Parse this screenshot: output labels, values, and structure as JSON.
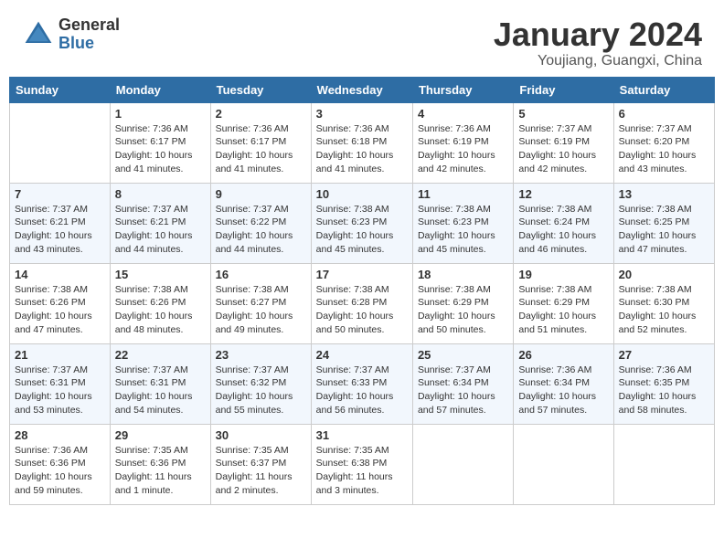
{
  "header": {
    "logo_general": "General",
    "logo_blue": "Blue",
    "month_title": "January 2024",
    "location": "Youjiang, Guangxi, China"
  },
  "weekdays": [
    "Sunday",
    "Monday",
    "Tuesday",
    "Wednesday",
    "Thursday",
    "Friday",
    "Saturday"
  ],
  "weeks": [
    [
      {
        "num": "",
        "info": ""
      },
      {
        "num": "1",
        "info": "Sunrise: 7:36 AM\nSunset: 6:17 PM\nDaylight: 10 hours\nand 41 minutes."
      },
      {
        "num": "2",
        "info": "Sunrise: 7:36 AM\nSunset: 6:17 PM\nDaylight: 10 hours\nand 41 minutes."
      },
      {
        "num": "3",
        "info": "Sunrise: 7:36 AM\nSunset: 6:18 PM\nDaylight: 10 hours\nand 41 minutes."
      },
      {
        "num": "4",
        "info": "Sunrise: 7:36 AM\nSunset: 6:19 PM\nDaylight: 10 hours\nand 42 minutes."
      },
      {
        "num": "5",
        "info": "Sunrise: 7:37 AM\nSunset: 6:19 PM\nDaylight: 10 hours\nand 42 minutes."
      },
      {
        "num": "6",
        "info": "Sunrise: 7:37 AM\nSunset: 6:20 PM\nDaylight: 10 hours\nand 43 minutes."
      }
    ],
    [
      {
        "num": "7",
        "info": "Sunrise: 7:37 AM\nSunset: 6:21 PM\nDaylight: 10 hours\nand 43 minutes."
      },
      {
        "num": "8",
        "info": "Sunrise: 7:37 AM\nSunset: 6:21 PM\nDaylight: 10 hours\nand 44 minutes."
      },
      {
        "num": "9",
        "info": "Sunrise: 7:37 AM\nSunset: 6:22 PM\nDaylight: 10 hours\nand 44 minutes."
      },
      {
        "num": "10",
        "info": "Sunrise: 7:38 AM\nSunset: 6:23 PM\nDaylight: 10 hours\nand 45 minutes."
      },
      {
        "num": "11",
        "info": "Sunrise: 7:38 AM\nSunset: 6:23 PM\nDaylight: 10 hours\nand 45 minutes."
      },
      {
        "num": "12",
        "info": "Sunrise: 7:38 AM\nSunset: 6:24 PM\nDaylight: 10 hours\nand 46 minutes."
      },
      {
        "num": "13",
        "info": "Sunrise: 7:38 AM\nSunset: 6:25 PM\nDaylight: 10 hours\nand 47 minutes."
      }
    ],
    [
      {
        "num": "14",
        "info": "Sunrise: 7:38 AM\nSunset: 6:26 PM\nDaylight: 10 hours\nand 47 minutes."
      },
      {
        "num": "15",
        "info": "Sunrise: 7:38 AM\nSunset: 6:26 PM\nDaylight: 10 hours\nand 48 minutes."
      },
      {
        "num": "16",
        "info": "Sunrise: 7:38 AM\nSunset: 6:27 PM\nDaylight: 10 hours\nand 49 minutes."
      },
      {
        "num": "17",
        "info": "Sunrise: 7:38 AM\nSunset: 6:28 PM\nDaylight: 10 hours\nand 50 minutes."
      },
      {
        "num": "18",
        "info": "Sunrise: 7:38 AM\nSunset: 6:29 PM\nDaylight: 10 hours\nand 50 minutes."
      },
      {
        "num": "19",
        "info": "Sunrise: 7:38 AM\nSunset: 6:29 PM\nDaylight: 10 hours\nand 51 minutes."
      },
      {
        "num": "20",
        "info": "Sunrise: 7:38 AM\nSunset: 6:30 PM\nDaylight: 10 hours\nand 52 minutes."
      }
    ],
    [
      {
        "num": "21",
        "info": "Sunrise: 7:37 AM\nSunset: 6:31 PM\nDaylight: 10 hours\nand 53 minutes."
      },
      {
        "num": "22",
        "info": "Sunrise: 7:37 AM\nSunset: 6:31 PM\nDaylight: 10 hours\nand 54 minutes."
      },
      {
        "num": "23",
        "info": "Sunrise: 7:37 AM\nSunset: 6:32 PM\nDaylight: 10 hours\nand 55 minutes."
      },
      {
        "num": "24",
        "info": "Sunrise: 7:37 AM\nSunset: 6:33 PM\nDaylight: 10 hours\nand 56 minutes."
      },
      {
        "num": "25",
        "info": "Sunrise: 7:37 AM\nSunset: 6:34 PM\nDaylight: 10 hours\nand 57 minutes."
      },
      {
        "num": "26",
        "info": "Sunrise: 7:36 AM\nSunset: 6:34 PM\nDaylight: 10 hours\nand 57 minutes."
      },
      {
        "num": "27",
        "info": "Sunrise: 7:36 AM\nSunset: 6:35 PM\nDaylight: 10 hours\nand 58 minutes."
      }
    ],
    [
      {
        "num": "28",
        "info": "Sunrise: 7:36 AM\nSunset: 6:36 PM\nDaylight: 10 hours\nand 59 minutes."
      },
      {
        "num": "29",
        "info": "Sunrise: 7:35 AM\nSunset: 6:36 PM\nDaylight: 11 hours\nand 1 minute."
      },
      {
        "num": "30",
        "info": "Sunrise: 7:35 AM\nSunset: 6:37 PM\nDaylight: 11 hours\nand 2 minutes."
      },
      {
        "num": "31",
        "info": "Sunrise: 7:35 AM\nSunset: 6:38 PM\nDaylight: 11 hours\nand 3 minutes."
      },
      {
        "num": "",
        "info": ""
      },
      {
        "num": "",
        "info": ""
      },
      {
        "num": "",
        "info": ""
      }
    ]
  ]
}
